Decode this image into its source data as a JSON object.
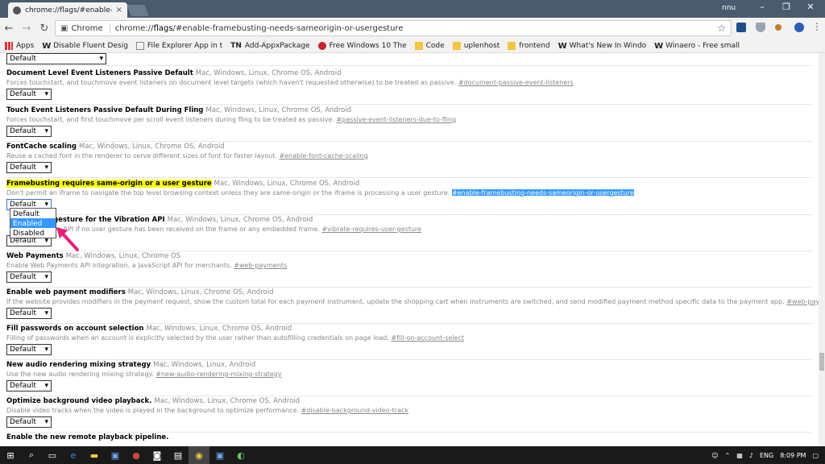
{
  "tab": {
    "title": "chrome://flags/#enable-f",
    "close": "×"
  },
  "window": {
    "user": "nnu",
    "minimize": "–",
    "restore": "❐",
    "close": "✕"
  },
  "omnibox": {
    "secure_label": "Chrome",
    "url_prefix": "chrome://",
    "url_bold": "flags",
    "url_rest": "/#enable-framebusting-needs-sameorigin-or-usergesture"
  },
  "bookmarks": [
    {
      "label": "Apps",
      "icon": "apps-icon"
    },
    {
      "label": "Disable Fluent Desig",
      "icon": "w-icon"
    },
    {
      "label": "File Explorer App in t",
      "icon": "page-icon"
    },
    {
      "label": "Add-AppxPackage",
      "icon": "tn-icon"
    },
    {
      "label": "Free Windows 10 The",
      "icon": "pinterest-icon"
    },
    {
      "label": "Code",
      "icon": "folder-icon"
    },
    {
      "label": "uplenhost",
      "icon": "folder-icon"
    },
    {
      "label": "frontend",
      "icon": "folder-icon"
    },
    {
      "label": "What's New In Windo",
      "icon": "w-icon"
    },
    {
      "label": "Winaero - Free small",
      "icon": "w-icon"
    }
  ],
  "bookmark_tn": "TN",
  "bookmark_w": "W",
  "top_select": "Default",
  "flags": [
    {
      "name": "Document Level Event Listeners Passive Default",
      "platforms": "Mac, Windows, Linux, Chrome OS, Android",
      "desc": "Forces touchstart, and touchmove event listeners on document level targets (which haven't requested otherwise) to be treated as passive.",
      "link": "#document-passive-event-listeners",
      "value": "Default"
    },
    {
      "name": "Touch Event Listeners Passive Default During Fling",
      "platforms": "Mac, Windows, Linux, Chrome OS, Android",
      "desc": "Forces touchstart, and first touchmove per scroll event listeners during fling to be treated as passive.",
      "link": "#passive-event-listeners-due-to-fling",
      "value": "Default"
    },
    {
      "name": "FontCache scaling",
      "platforms": "Mac, Windows, Linux, Chrome OS, Android",
      "desc": "Reuse a cached font in the renderer to serve different sizes of font for faster layout.",
      "link": "#enable-font-cache-scaling",
      "value": "Default"
    },
    {
      "name": "Framebusting requires same-origin or a user gesture",
      "platforms": "Mac, Windows, Linux, Chrome OS, Android",
      "desc": "Don't permit an iframe to navigate the top level browsing context unless they are same-origin or the iframe is processing a user gesture.",
      "link": "#enable-framebusting-needs-sameorigin-or-usergesture",
      "value": "Default"
    },
    {
      "name": "gesture for the Vibration API",
      "platforms": "Mac, Windows, Linux, Chrome OS, Android",
      "desc": "on API if no user gesture has been received on the frame or any embedded frame.",
      "link": "#vibrate-requires-user-gesture",
      "value": "Default"
    },
    {
      "name": "Web Payments",
      "platforms": "Mac, Windows, Linux, Chrome OS",
      "desc": "Enable Web Payments API integration, a JavaScript API for merchants.",
      "link": "#web-payments",
      "value": "Default"
    },
    {
      "name": "Enable web payment modifiers",
      "platforms": "Mac, Windows, Linux, Chrome OS, Android",
      "desc": "If the website provides modifiers in the payment request, show the custom total for each payment instrument, update the shopping cart when instruments are switched, and send modified payment method specific data to the payment app.",
      "link": "#web-payments-modifiers",
      "value": "Default"
    },
    {
      "name": "Fill passwords on account selection",
      "platforms": "Mac, Windows, Linux, Chrome OS, Android",
      "desc": "Filling of passwords when an account is explicitly selected by the user rather than autofilling credentials on page load.",
      "link": "#fill-on-account-select",
      "value": "Default"
    },
    {
      "name": "New audio rendering mixing strategy",
      "platforms": "Mac, Windows, Linux, Android",
      "desc": "Use the new audio rendering mixing strategy.",
      "link": "#new-audio-rendering-mixing-strategy",
      "value": "Default"
    },
    {
      "name": "Optimize background video playback.",
      "platforms": "Mac, Windows, Linux, Chrome OS, Android",
      "desc": "Disable video tracks when the video is played in the background to optimize performance.",
      "link": "#disable-background-video-track",
      "value": "Default"
    },
    {
      "name": "Enable the new remote playback pipeline.",
      "platforms": "",
      "desc": "",
      "link": "",
      "value": ""
    }
  ],
  "dropdown_options": [
    "Default",
    "Enabled",
    "Disabled"
  ],
  "taskbar": {
    "lang": "ENG",
    "time": "8:09 PM"
  },
  "colors": {
    "highlight": "#ffff00",
    "selection": "#3399ff",
    "arrow": "#e8207a"
  }
}
